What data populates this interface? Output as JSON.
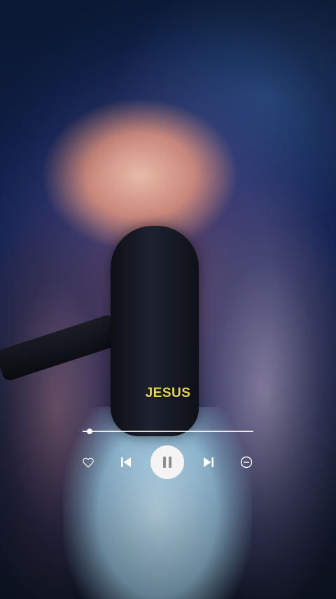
{
  "player": {
    "song_title": "JESUS",
    "progress": 0.04
  },
  "controls": {
    "like_icon": "heart-outline-icon",
    "prev_icon": "skip-previous-icon",
    "play_pause_icon": "pause-icon",
    "next_icon": "skip-next-icon",
    "remove_icon": "minus-circle-icon"
  },
  "colors": {
    "title": "#e8d64a",
    "controls": "#ffffff",
    "play_button_bg": "#f4f4f4",
    "play_button_icon": "#8e8e8e"
  }
}
